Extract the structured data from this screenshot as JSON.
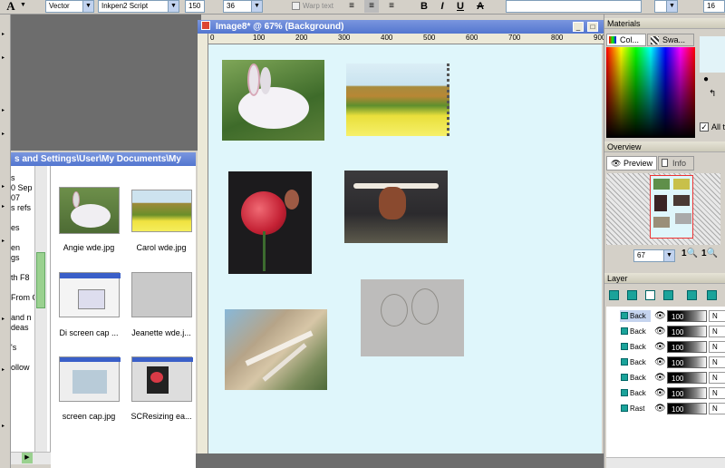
{
  "toolbar": {
    "text_tool": "A",
    "create_as": "Vector",
    "font": "Inkpen2 Script",
    "size": "150",
    "size2": "36",
    "warp_text": "Warp text",
    "bold": "B",
    "italic": "I",
    "underline": "U",
    "strike": "A",
    "num_right": "16"
  },
  "explorer": {
    "path": "s and Settings\\User\\My Documents\\My",
    "tree": [
      "s",
      "0 Sep",
      "07",
      "s refs",
      "",
      "es",
      "",
      "en",
      "gs",
      "",
      "th F8",
      "",
      "From C",
      "",
      "and n",
      "deas",
      "",
      "'s",
      "",
      "ollow"
    ],
    "files": [
      {
        "name": "Angie wde.jpg",
        "type": "rabbit"
      },
      {
        "name": "Carol wde.jpg",
        "type": "hills"
      },
      {
        "name": "Di screen cap ...",
        "type": "screen"
      },
      {
        "name": "Jeanette wde.j...",
        "type": "sketch"
      },
      {
        "name": "screen cap.jpg",
        "type": "screen2"
      },
      {
        "name": "SCResizing ea...",
        "type": "rosescreen"
      }
    ]
  },
  "canvas": {
    "title": "Image8* @  67% (Background)",
    "ruler": [
      "0",
      "100",
      "200",
      "300",
      "400",
      "500",
      "600",
      "700",
      "800",
      "900"
    ]
  },
  "materials": {
    "title": "Materials",
    "tab_color": "Col...",
    "tab_swatches": "Swa...",
    "all_tools": "All t"
  },
  "overview": {
    "title": "Overview",
    "tab_preview": "Preview",
    "tab_info": "Info",
    "zoom": "67"
  },
  "layers": {
    "title": "Layer",
    "rows": [
      {
        "name": "Back",
        "opacity": "100",
        "mode": "N",
        "selected": true
      },
      {
        "name": "Back",
        "opacity": "100",
        "mode": "N",
        "selected": false
      },
      {
        "name": "Back",
        "opacity": "100",
        "mode": "N",
        "selected": false
      },
      {
        "name": "Back",
        "opacity": "100",
        "mode": "N",
        "selected": false
      },
      {
        "name": "Back",
        "opacity": "100",
        "mode": "N",
        "selected": false
      },
      {
        "name": "Back",
        "opacity": "100",
        "mode": "N",
        "selected": false
      },
      {
        "name": "Rast",
        "opacity": "100",
        "mode": "N",
        "selected": false
      }
    ]
  },
  "colors": {
    "canvas_bg": "#dff6fb",
    "titlebar": "#5376d0",
    "workspace": "#6d6d6d"
  }
}
